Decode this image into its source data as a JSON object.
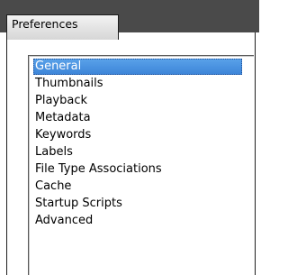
{
  "window": {
    "title": "Preferences"
  },
  "list": {
    "selected_index": 0,
    "items": [
      "General",
      "Thumbnails",
      "Playback",
      "Metadata",
      "Keywords",
      "Labels",
      "File Type Associations",
      "Cache",
      "Startup Scripts",
      "Advanced"
    ]
  },
  "colors": {
    "titlebar": "#4a4a4a",
    "selection": "#3c84d8",
    "selection_text": "#ffffff"
  }
}
